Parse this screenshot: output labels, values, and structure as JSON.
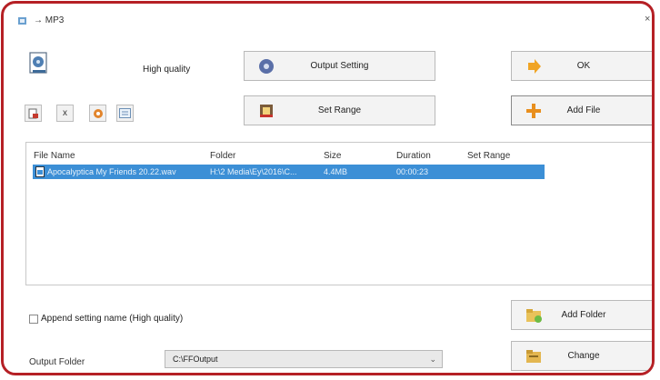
{
  "window": {
    "title": "→ MP3",
    "close_glyph": "×",
    "border_color": "#b52025"
  },
  "profile": {
    "quality_label": "High quality"
  },
  "toolbar_small": [
    "",
    "x",
    "",
    ""
  ],
  "buttons": {
    "output_setting": "Output Setting",
    "set_range": "Set Range",
    "ok": "OK",
    "add_file": "Add File",
    "add_folder": "Add Folder",
    "change": "Change"
  },
  "file_list": {
    "columns": [
      "File Name",
      "Folder",
      "Size",
      "Duration",
      "Set Range"
    ],
    "rows": [
      {
        "file_name": "Apocalyptica My Friends 20.22.wav",
        "folder": "H:\\2 Media\\Ey\\2016\\C...",
        "size": "4.4MB",
        "duration": "00:00:23",
        "set_range": ""
      }
    ],
    "selected_color": "#3c8fd6"
  },
  "append_setting": {
    "label": "Append setting name (High quality)",
    "checked": false
  },
  "output_folder": {
    "label": "Output Folder",
    "value": "C:\\FFOutput",
    "arrow": "⌄"
  }
}
